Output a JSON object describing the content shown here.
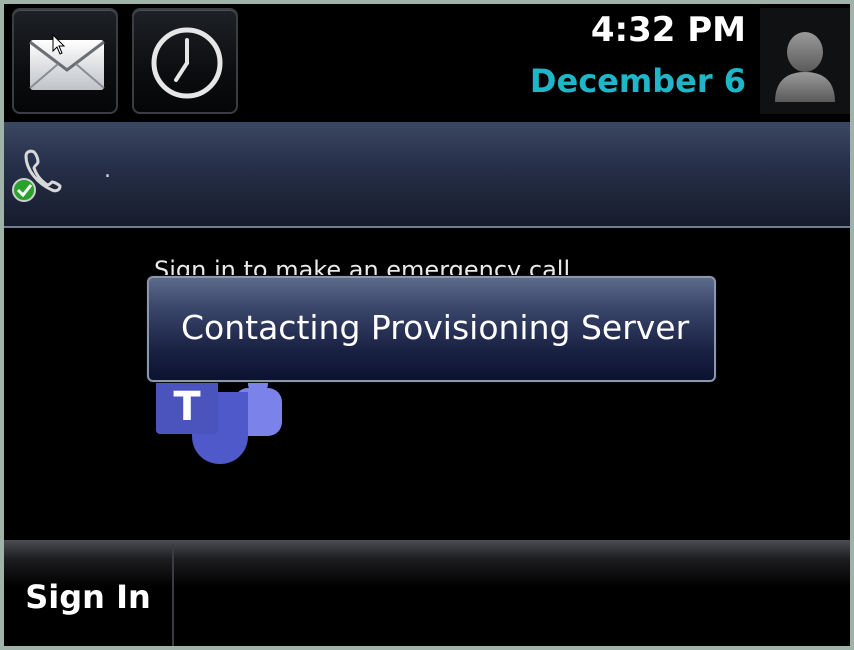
{
  "statusbar": {
    "time": "4:32 PM",
    "date": "December 6"
  },
  "icons": {
    "mail": "mail-icon",
    "clock": "clock-icon",
    "avatar": "user-avatar-icon",
    "line": "phone-registered-icon",
    "teams": "microsoft-teams-icon"
  },
  "line": {
    "label": "."
  },
  "main": {
    "emergency_text": "Sign in to make an emergency call"
  },
  "popup": {
    "message": "Contacting Provisioning Server"
  },
  "softkeys": {
    "sign_in": "Sign In"
  },
  "colors": {
    "date": "#1fb7c7",
    "teams_purple": "#5059c9",
    "teams_dark": "#4b53bc",
    "popup_bg": "#1a2244"
  }
}
